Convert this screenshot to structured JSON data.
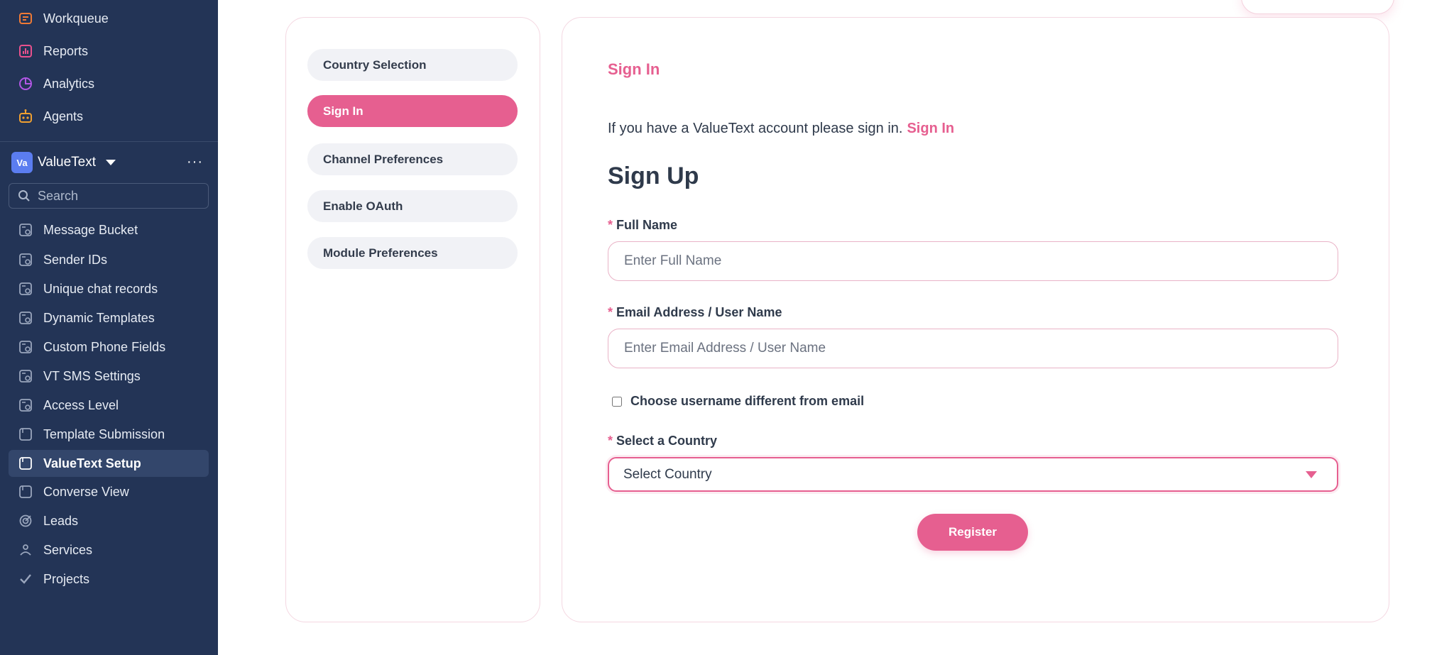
{
  "sidebar": {
    "top_items": [
      {
        "label": "Workqueue",
        "icon": "workqueue-icon"
      },
      {
        "label": "Reports",
        "icon": "reports-icon"
      },
      {
        "label": "Analytics",
        "icon": "analytics-icon"
      },
      {
        "label": "Agents",
        "icon": "agents-icon"
      }
    ],
    "workspace": {
      "badge": "Va",
      "name": "ValueText"
    },
    "search_placeholder": "Search",
    "items": [
      {
        "label": "Message Bucket"
      },
      {
        "label": "Sender IDs"
      },
      {
        "label": "Unique chat records"
      },
      {
        "label": "Dynamic Templates"
      },
      {
        "label": "Custom Phone Fields"
      },
      {
        "label": "VT SMS Settings"
      },
      {
        "label": "Access Level"
      },
      {
        "label": "Template Submission"
      },
      {
        "label": "ValueText Setup",
        "active": true
      },
      {
        "label": "Converse View"
      },
      {
        "label": "Leads"
      },
      {
        "label": "Services"
      },
      {
        "label": "Projects"
      }
    ]
  },
  "steps": [
    {
      "label": "Country Selection"
    },
    {
      "label": "Sign In",
      "active": true
    },
    {
      "label": "Channel Preferences"
    },
    {
      "label": "Enable OAuth"
    },
    {
      "label": "Module Preferences"
    }
  ],
  "form": {
    "section_title": "Sign In",
    "intro_text": "If you have a ValueText account please sign in.",
    "intro_link": "Sign In",
    "heading": "Sign Up",
    "required_mark": "*",
    "full_name_label": "Full Name",
    "full_name_placeholder": "Enter Full Name",
    "email_label": "Email Address / User Name",
    "email_placeholder": "Enter Email Address / User Name",
    "checkbox_label": "Choose username different from email",
    "country_label": "Select a Country",
    "country_value": "Select Country",
    "register_label": "Register"
  },
  "colors": {
    "sidebar_bg": "#233456",
    "accent": "#e65f90"
  }
}
